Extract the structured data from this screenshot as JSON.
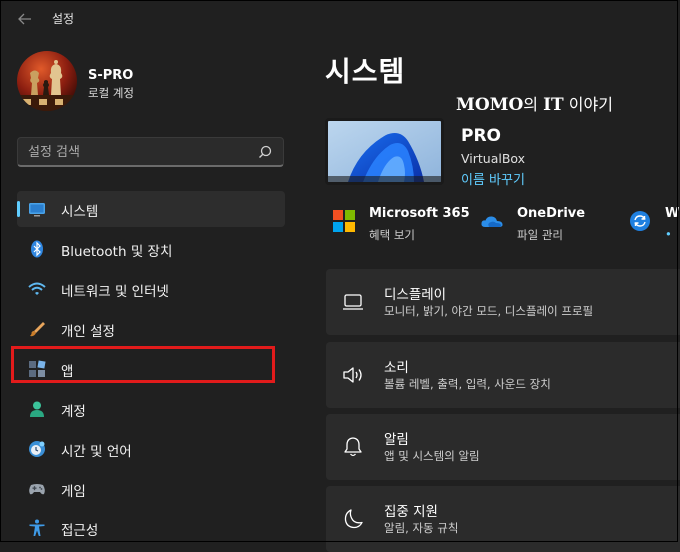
{
  "window": {
    "title": "설정"
  },
  "profile": {
    "name": "S-PRO",
    "account": "로컬 계정"
  },
  "search": {
    "placeholder": "설정 검색"
  },
  "sidebar": {
    "items": [
      {
        "label": "시스템",
        "icon": "system-icon",
        "active": true
      },
      {
        "label": "Bluetooth 및 장치",
        "icon": "bluetooth-icon"
      },
      {
        "label": "네트워크 및 인터넷",
        "icon": "wifi-icon"
      },
      {
        "label": "개인 설정",
        "icon": "brush-icon"
      },
      {
        "label": "앱",
        "icon": "apps-icon",
        "highlighted": true
      },
      {
        "label": "계정",
        "icon": "account-icon"
      },
      {
        "label": "시간 및 언어",
        "icon": "time-language-icon"
      },
      {
        "label": "게임",
        "icon": "gamepad-icon"
      },
      {
        "label": "접근성",
        "icon": "accessibility-icon"
      }
    ]
  },
  "main": {
    "title": "시스템",
    "watermark": {
      "brand": "MOMO",
      "connector": "의 ",
      "it": "IT",
      "suffix": " 이야기"
    },
    "device": {
      "name": "PRO",
      "model": "VirtualBox",
      "rename_label": "이름 바꾸기"
    },
    "quick_links": [
      {
        "title": "Microsoft 365",
        "subtitle": "혜택 보기",
        "icon": "microsoft-icon"
      },
      {
        "title": "OneDrive",
        "subtitle": "파일 관리",
        "icon": "onedrive-icon"
      },
      {
        "title": "W",
        "subtitle": "•",
        "icon": "windows-update-icon"
      }
    ],
    "cards": [
      {
        "title": "디스플레이",
        "subtitle": "모니터, 밝기, 야간 모드, 디스플레이 프로필",
        "icon": "display-icon"
      },
      {
        "title": "소리",
        "subtitle": "볼륨 레벨, 출력, 입력, 사운드 장치",
        "icon": "speaker-icon"
      },
      {
        "title": "알림",
        "subtitle": "앱 및 시스템의 알림",
        "icon": "bell-icon"
      },
      {
        "title": "집중 지원",
        "subtitle": "알림, 자동 규칙",
        "icon": "moon-icon"
      }
    ]
  },
  "colors": {
    "accent": "#60cdff",
    "background": "#202020",
    "card": "#2b2b2b",
    "highlight": "#e21b1b"
  }
}
